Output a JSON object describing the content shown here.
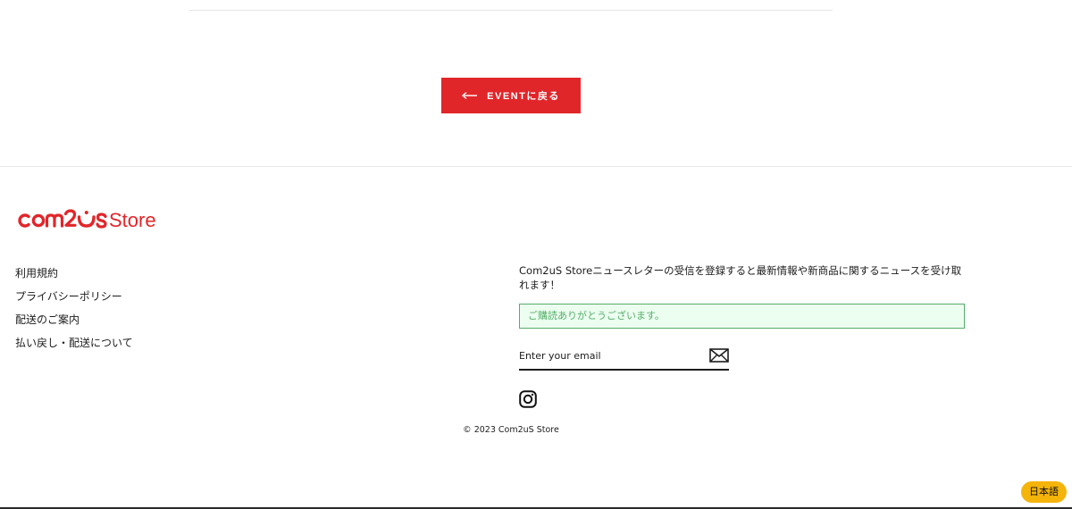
{
  "back_button": {
    "label": "EVENTに戻る",
    "icon": "arrow-left-icon"
  },
  "footer": {
    "logo_text": "Com2uS Store",
    "links": [
      "利用規約",
      "プライバシーポリシー",
      "配送のご案内",
      "払い戻し・配送について"
    ],
    "newsletter": {
      "description": "Com2uS Storeニュースレターの受信を登録すると最新情報や新商品に関するニュースを受け取れます！",
      "success_message": "ご購読ありがとうございます。",
      "email_placeholder": "Enter your email",
      "submit_icon": "envelope-icon"
    },
    "social_icon": "instagram-icon",
    "copyright": "© 2023 Com2uS Store"
  },
  "language_badge": "日本語",
  "colors": {
    "brand_red": "#e1262a",
    "success_green": "#56ad6a",
    "success_bg": "#ecfef0",
    "language_badge_bg": "#f5b40a"
  }
}
